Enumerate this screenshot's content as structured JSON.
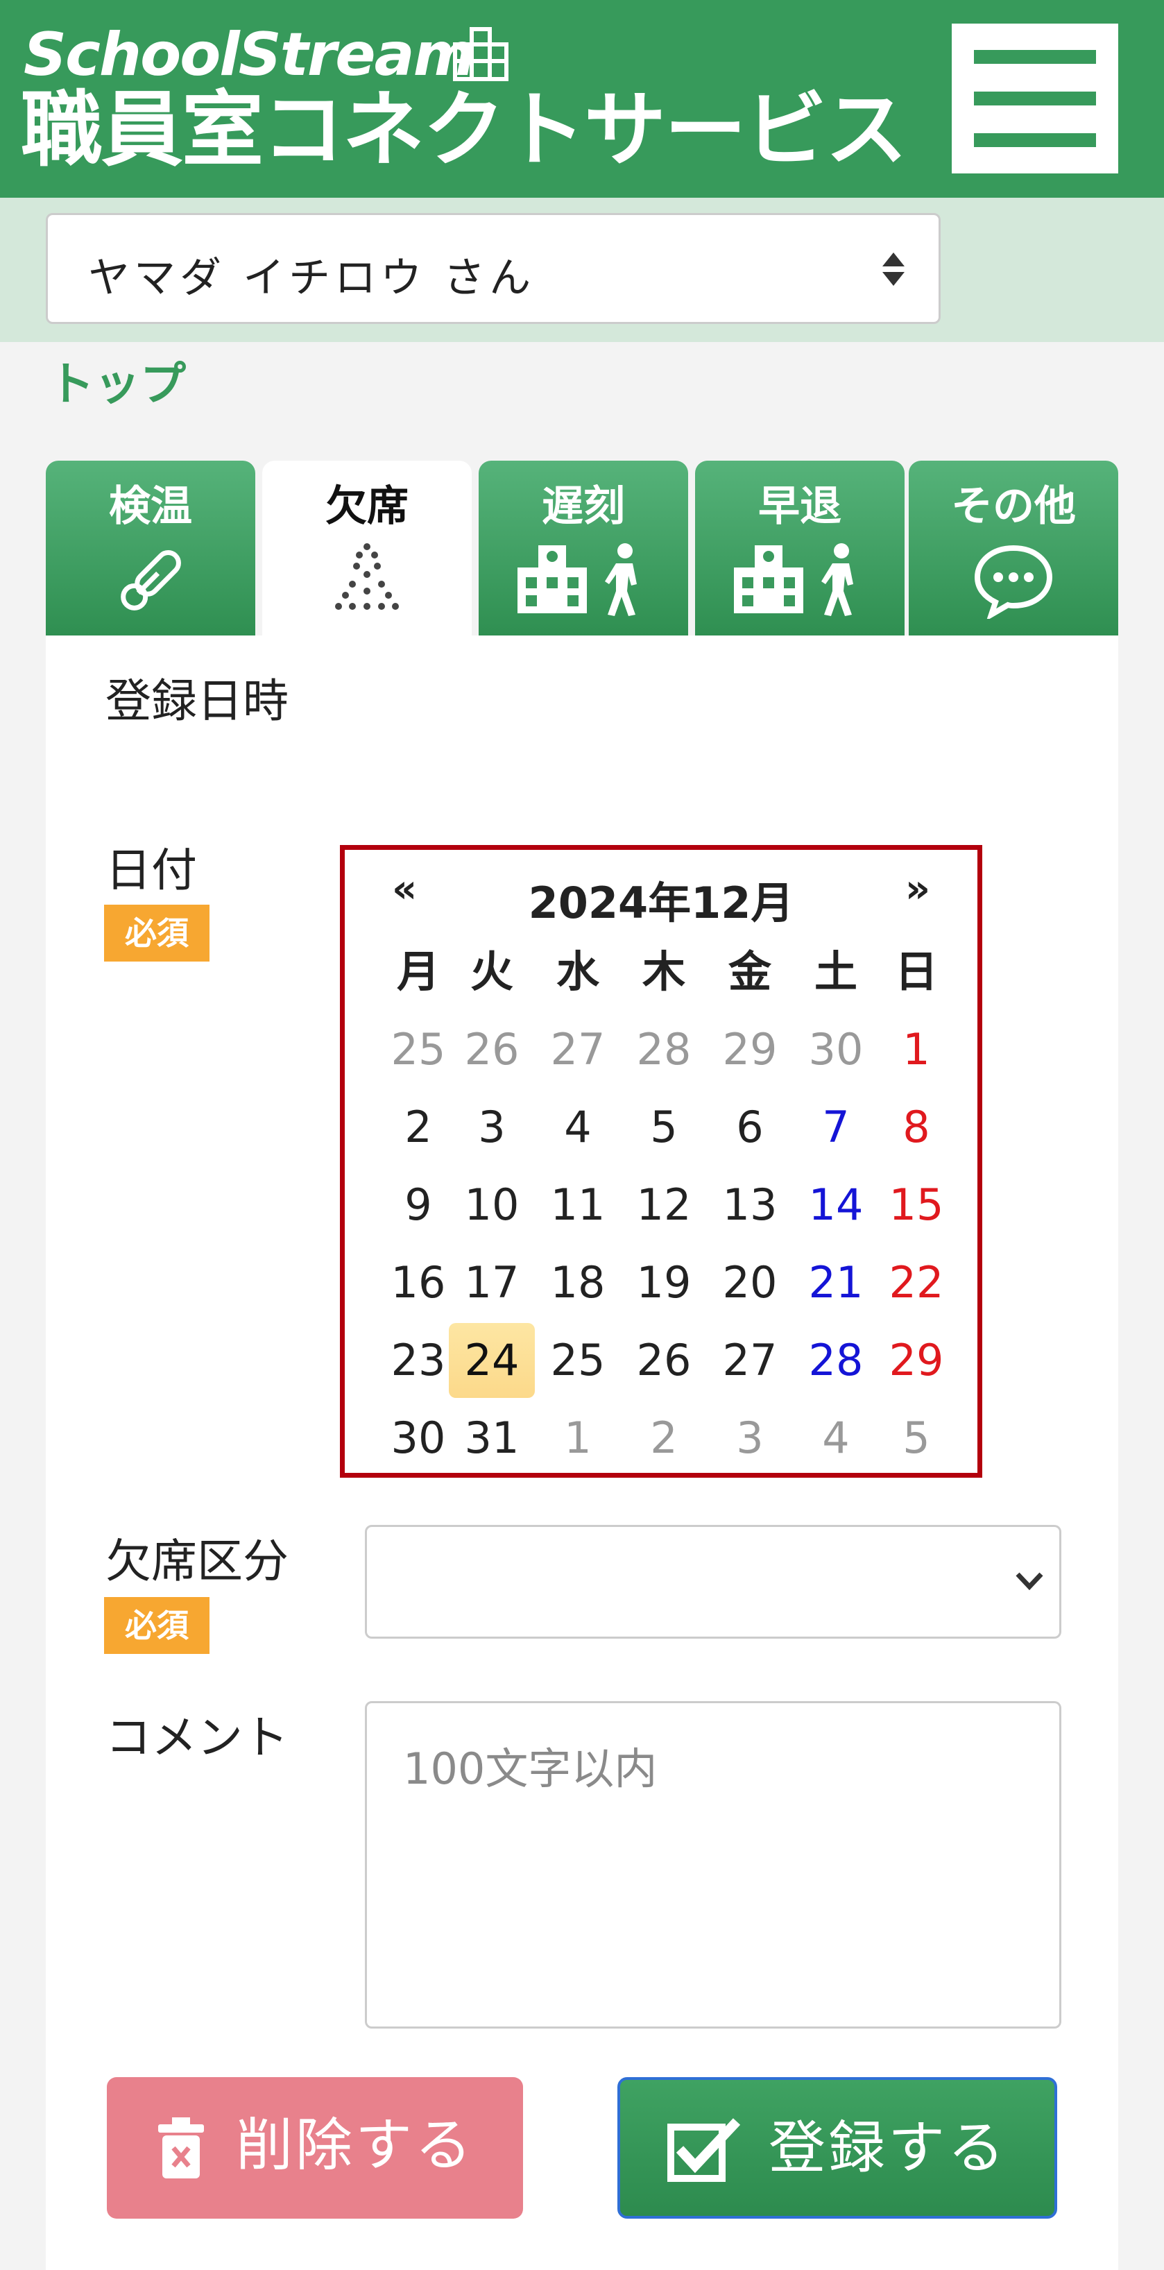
{
  "header": {
    "brand_en": "SchoolStream",
    "brand_jp": "職員室コネクトサービス",
    "menu_icon": "hamburger-icon"
  },
  "student": {
    "selected": "ヤマダ イチロウ さん"
  },
  "breadcrumb": "トップ",
  "tabs": [
    {
      "label": "検温",
      "icon": "thermometer-icon"
    },
    {
      "label": "欠席",
      "icon": "dots-icon"
    },
    {
      "label": "遅刻",
      "icon": "school-walk-icon"
    },
    {
      "label": "早退",
      "icon": "school-walk-icon"
    },
    {
      "label": "その他",
      "icon": "chat-bubble-icon"
    }
  ],
  "form": {
    "registered_label": "登録日時",
    "date_label": "日付",
    "required_badge": "必須",
    "absence_label": "欠席区分",
    "absence_value": "",
    "comment_label": "コメント",
    "comment_placeholder": "100文字以内"
  },
  "calendar": {
    "prev": "«",
    "next": "»",
    "title": "2024年12月",
    "weekdays": [
      "月",
      "火",
      "水",
      "木",
      "金",
      "土",
      "日"
    ],
    "selected_day": "24",
    "weeks": [
      [
        "25",
        "26",
        "27",
        "28",
        "29",
        "30",
        "1"
      ],
      [
        "2",
        "3",
        "4",
        "5",
        "6",
        "7",
        "8"
      ],
      [
        "9",
        "10",
        "11",
        "12",
        "13",
        "14",
        "15"
      ],
      [
        "16",
        "17",
        "18",
        "19",
        "20",
        "21",
        "22"
      ],
      [
        "23",
        "24",
        "25",
        "26",
        "27",
        "28",
        "29"
      ],
      [
        "30",
        "31",
        "1",
        "2",
        "3",
        "4",
        "5"
      ]
    ]
  },
  "buttons": {
    "delete": "削除する",
    "register": "登録する"
  },
  "colors": {
    "brand_green": "#379a5b",
    "required_orange": "#f7a731",
    "delete_pink": "#e8818c",
    "calendar_border": "#b3000d",
    "saturday": "#1414d6",
    "sunday": "#e0191e",
    "today_highlight": "#fde6a3"
  }
}
